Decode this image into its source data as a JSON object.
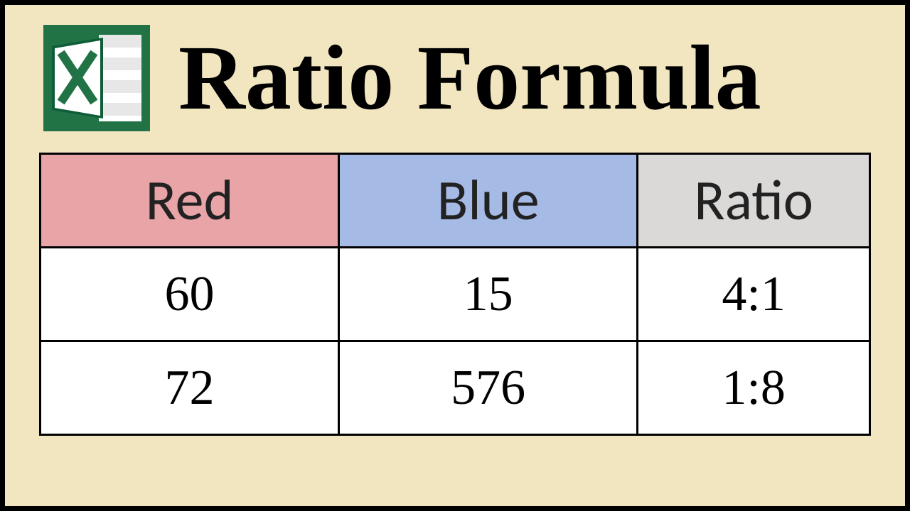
{
  "title": "Ratio Formula",
  "icon": "excel-icon",
  "colors": {
    "card_bg": "#f2e6c1",
    "border": "#000000",
    "header_red": "#e8a4a6",
    "header_blue": "#a6bae6",
    "header_ratio": "#dbd8d8",
    "cell_bg": "#ffffff",
    "excel_green": "#217346"
  },
  "chart_data": {
    "type": "table",
    "columns": [
      "Red",
      "Blue",
      "Ratio"
    ],
    "rows": [
      {
        "red": 60,
        "blue": 15,
        "ratio": "4:1"
      },
      {
        "red": 72,
        "blue": 576,
        "ratio": "1:8"
      }
    ]
  }
}
